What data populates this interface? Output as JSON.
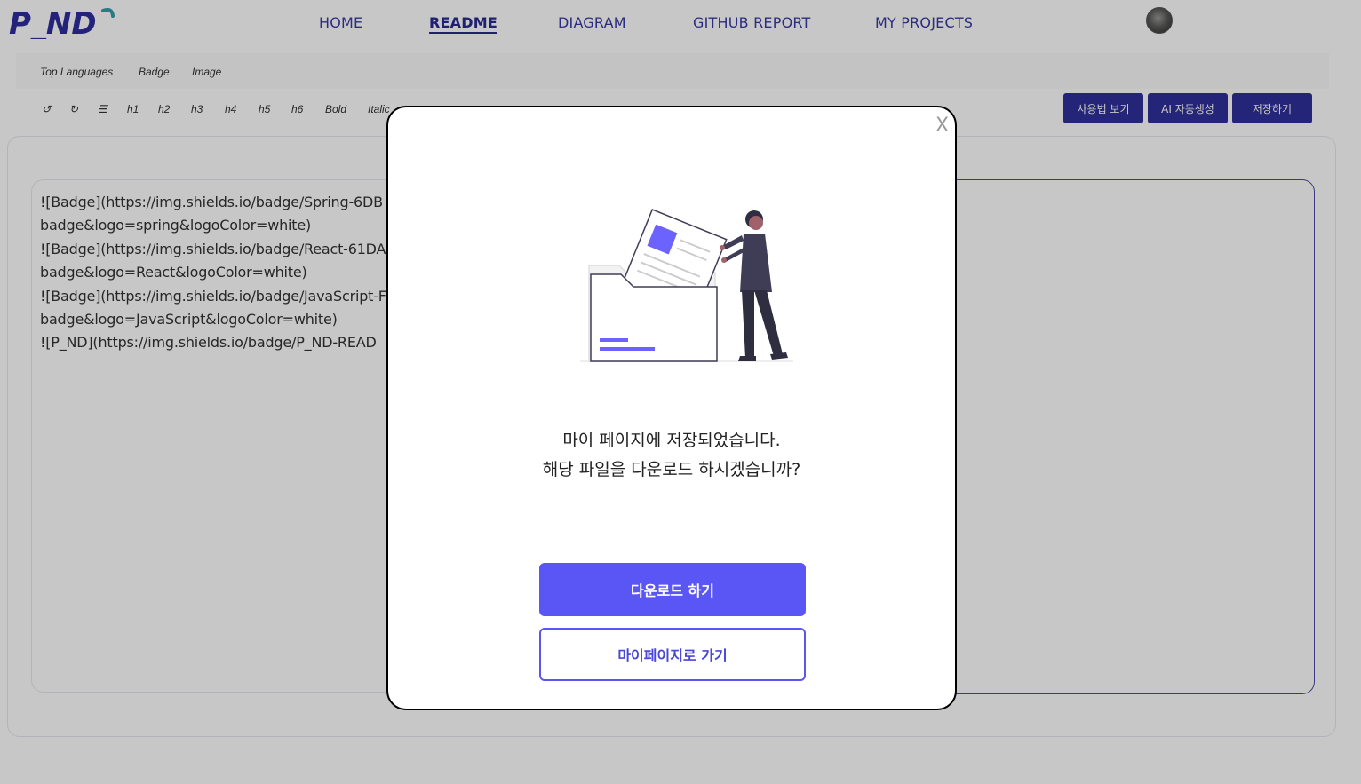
{
  "header": {
    "logo_text": "P_ND",
    "nav": [
      {
        "label": "HOME"
      },
      {
        "label": "README"
      },
      {
        "label": "DIAGRAM"
      },
      {
        "label": "GITHUB REPORT"
      },
      {
        "label": "MY PROJECTS"
      }
    ],
    "active_tab": "README"
  },
  "toolbar": {
    "row1": [
      "Top Languages",
      "Badge",
      "Image"
    ],
    "row2": [
      "↺",
      "↻",
      "☰",
      "h1",
      "h2",
      "h3",
      "h4",
      "h5",
      "h6",
      "Bold",
      "Italic"
    ],
    "buttons": {
      "usage": "사용법 보기",
      "ai": "AI 자동생성",
      "save": "저장하기"
    }
  },
  "editor": {
    "lines": [
      "![Badge](https://img.shields.io/badge/Spring-6DB",
      "badge&logo=spring&logoColor=white)",
      "![Badge](https://img.shields.io/badge/React-61DA",
      "badge&logo=React&logoColor=white)",
      "![Badge](https://img.shields.io/badge/JavaScript-F",
      "badge&logo=JavaScript&logoColor=white)",
      "![P_ND](https://img.shields.io/badge/P_ND-READ"
    ]
  },
  "modal": {
    "close_label": "X",
    "message_line1": "마이 페이지에 저장되었습니다.",
    "message_line2": "해당 파일을 다운로드 하시겠습니까?",
    "primary_button": "다운로드 하기",
    "secondary_button": "마이페이지로 가기"
  },
  "colors": {
    "accent": "#5a55f5",
    "nav_text": "#3a3aa3",
    "dark_button": "#2f2f9a"
  }
}
